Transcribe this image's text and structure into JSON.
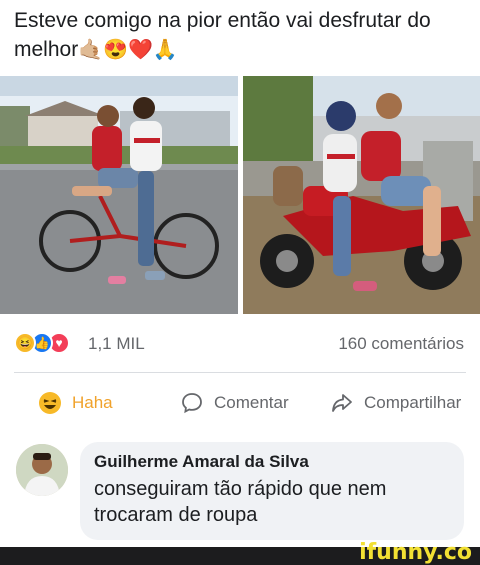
{
  "post": {
    "text": "Esteve comigo na pior então vai desfrutar do melhor",
    "emojis": "🤙🏼😍❤️🙏"
  },
  "photos": {
    "left_icon": "bicycle-photo",
    "right_icon": "motorcycle-photo"
  },
  "stats": {
    "reaction_icons": [
      "haha-icon",
      "like-icon",
      "love-icon"
    ],
    "reaction_count": "1,1 MIL",
    "comment_count": "160 comentários"
  },
  "actions": {
    "haha_label": "Haha",
    "comment_label": "Comentar",
    "share_label": "Compartilhar"
  },
  "comment": {
    "author": "Guilherme Amaral da Silva",
    "text": "conseguiram tão rápido que nem trocaram de roupa"
  },
  "watermark": {
    "logo": "ifunny.co"
  },
  "colors": {
    "haha": "#f0a22b",
    "like": "#1877f2",
    "love": "#f33e58",
    "watermark_yellow": "#f2e033"
  }
}
